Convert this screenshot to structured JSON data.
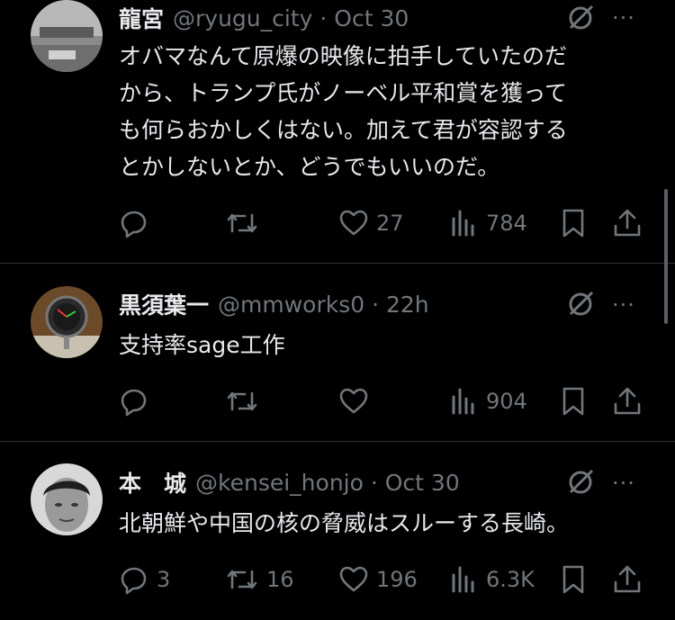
{
  "tweets": [
    {
      "name": "龍宮",
      "handle": "@ryugu_city · Oct 30",
      "text_lines": [
        "オバマなんて原爆の映像に拍手していたのだ",
        "から、トランプ氏がノーベル平和賞を獲って",
        "も何らおかしくはない。加えて君が容認する",
        "とかしないとか、どうでもいいのだ。"
      ],
      "replies": "",
      "reposts": "",
      "likes": "27",
      "views": "784"
    },
    {
      "name": "黒須葉一",
      "handle": "@mmworks0 · 22h",
      "text_lines": [
        "支持率sage工作"
      ],
      "replies": "",
      "reposts": "",
      "likes": "",
      "views": "904"
    },
    {
      "name": "本　城",
      "handle": "@kensei_honjo · Oct 30",
      "text_lines": [
        "北朝鮮や中国の核の脅威はスルーする長崎。"
      ],
      "replies": "3",
      "reposts": "16",
      "likes": "196",
      "views": "6.3K"
    }
  ],
  "icons": {
    "reply": "reply-icon",
    "repost": "repost-icon",
    "like": "like-icon",
    "views": "views-icon",
    "bookmark": "bookmark-icon",
    "share": "share-icon",
    "grok": "grok-icon",
    "more": "more-icon"
  },
  "colors": {
    "background": "#000000",
    "text": "#e7e9ea",
    "muted": "#71767b",
    "divider": "#2f3336"
  },
  "more_glyph": "···"
}
